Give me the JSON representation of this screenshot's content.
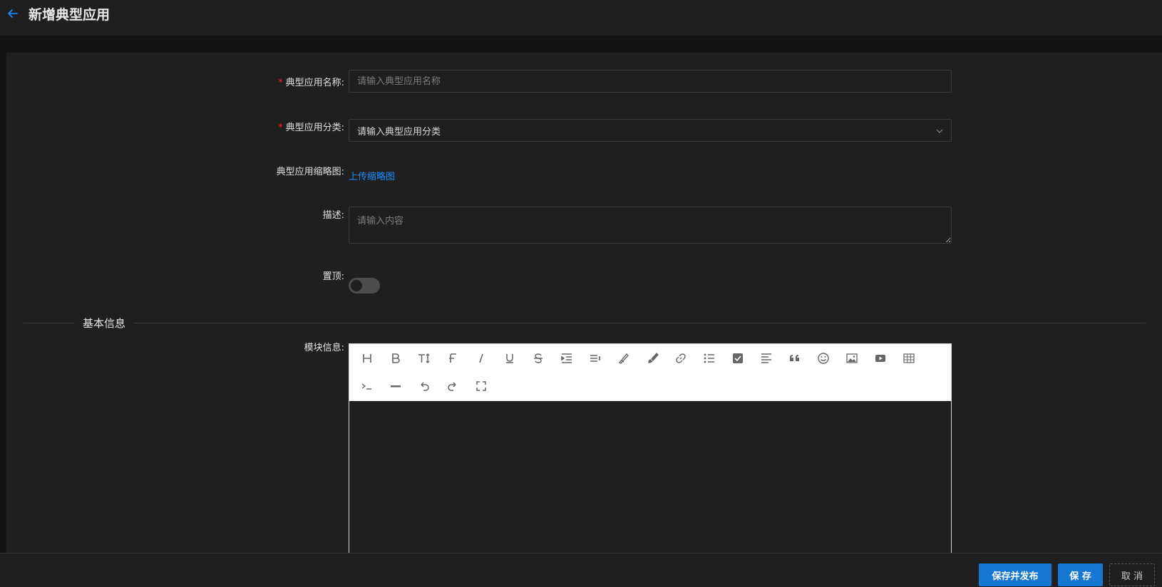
{
  "header": {
    "title": "新增典型应用"
  },
  "form": {
    "name": {
      "label": "典型应用名称:",
      "required": "*",
      "placeholder": "请输入典型应用名称"
    },
    "category": {
      "label": "典型应用分类:",
      "required": "*",
      "value": "请输入典型应用分类"
    },
    "thumbnail": {
      "label": "典型应用缩略图:",
      "link": "上传缩略图"
    },
    "description": {
      "label": "描述:",
      "placeholder": "请输入内容"
    },
    "pin": {
      "label": "置顶:",
      "enabled": false
    }
  },
  "section": {
    "title": "基本信息"
  },
  "editor": {
    "label": "模块信息:",
    "tools": [
      "heading-icon",
      "bold-icon",
      "font-size-icon",
      "font-icon",
      "italic-icon",
      "underline-icon",
      "strikethrough-icon",
      "indent-icon",
      "line-height-icon",
      "fore-color-icon",
      "background-color-icon",
      "link-icon",
      "bullet-list-icon",
      "todo-icon",
      "justify-icon",
      "quote-icon",
      "emoticon-icon",
      "image-icon",
      "video-icon",
      "table-icon",
      "code-icon",
      "divider-icon",
      "undo-icon",
      "redo-icon",
      "fullscreen-icon"
    ]
  },
  "footer": {
    "publish_label": "保存并发布",
    "save_label": "保 存",
    "cancel_label": "取 消"
  },
  "colors": {
    "accent": "#1890ff",
    "primary_button": "#1677d2",
    "required": "#f5222d"
  }
}
